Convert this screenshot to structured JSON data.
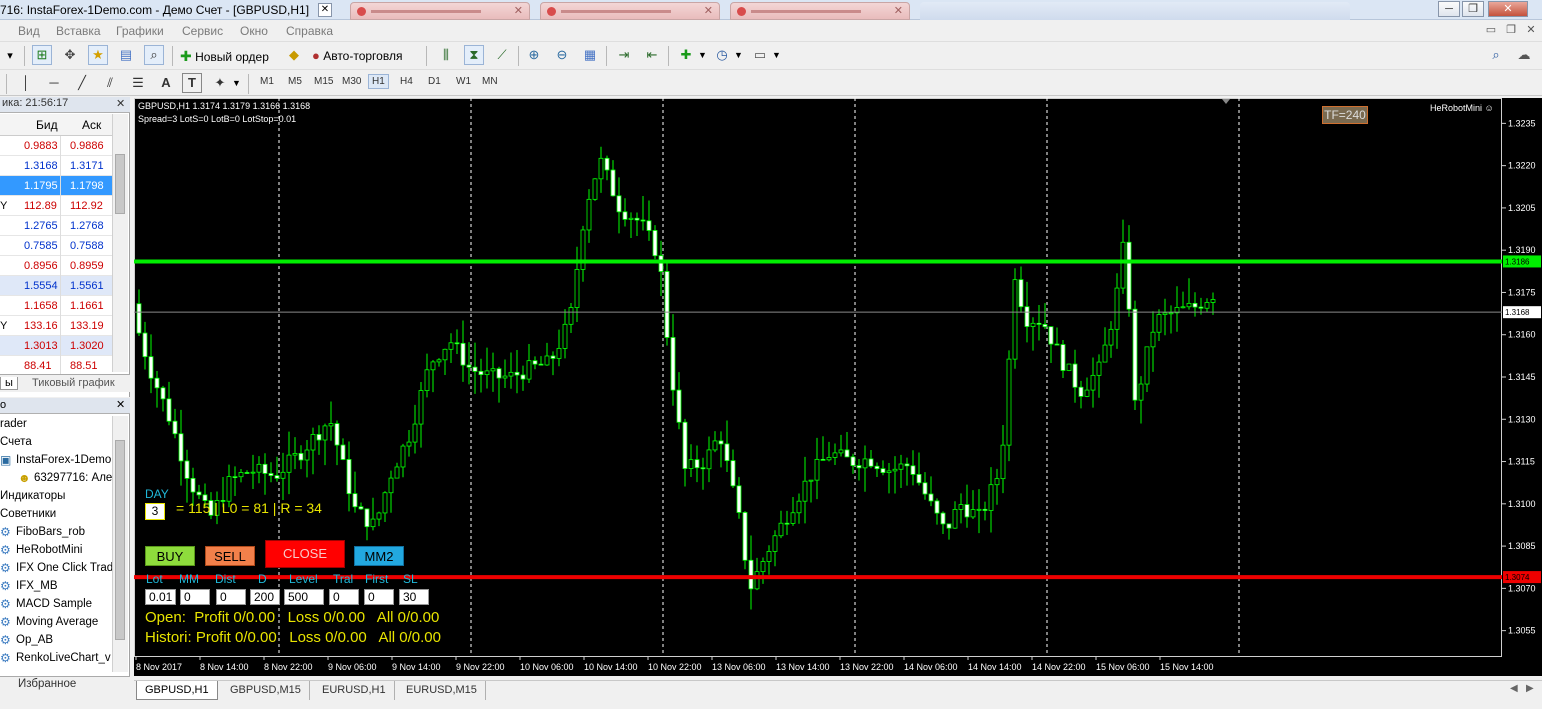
{
  "window": {
    "title": "716: InstaForex-1Demo.com - Демо Счет - [GBPUSD,H1]",
    "buttons": {
      "minimize": "─",
      "restore": "❐",
      "close": "✕"
    }
  },
  "menu": [
    "Вид",
    "Вставка",
    "Графики",
    "Сервис",
    "Окно",
    "Справка"
  ],
  "toolbar": {
    "new_order": "Новый ордер",
    "autotrading": "Авто-торговля",
    "timeframes": [
      "M1",
      "M5",
      "M15",
      "M30",
      "H1",
      "H4",
      "D1",
      "W1",
      "MN"
    ],
    "active_timeframe": "H1",
    "draw_text_tool": "A",
    "text_label_tool": "T"
  },
  "market_watch": {
    "time_header": "ика: 21:56:17",
    "col_bid": "Бид",
    "col_ask": "Аск",
    "rows": [
      {
        "sym": "",
        "bid": "0.9883",
        "ask": "0.9886",
        "color": "#cc0000",
        "bg": "#ffffff"
      },
      {
        "sym": "",
        "bid": "1.3168",
        "ask": "1.3171",
        "color": "#0033cc",
        "bg": "#ffffff"
      },
      {
        "sym": "",
        "bid": "1.1795",
        "ask": "1.1798",
        "color": "#ffffff",
        "bg": "#3399ff"
      },
      {
        "sym": "Y",
        "bid": "112.89",
        "ask": "112.92",
        "color": "#cc0000",
        "bg": "#ffffff"
      },
      {
        "sym": "",
        "bid": "1.2765",
        "ask": "1.2768",
        "color": "#0033cc",
        "bg": "#ffffff"
      },
      {
        "sym": "",
        "bid": "0.7585",
        "ask": "0.7588",
        "color": "#0033cc",
        "bg": "#ffffff"
      },
      {
        "sym": "",
        "bid": "0.8956",
        "ask": "0.8959",
        "color": "#cc0000",
        "bg": "#ffffff"
      },
      {
        "sym": "",
        "bid": "1.5554",
        "ask": "1.5561",
        "color": "#0033cc",
        "bg": "#dfe8f8"
      },
      {
        "sym": "",
        "bid": "1.1658",
        "ask": "1.1661",
        "color": "#cc0000",
        "bg": "#ffffff"
      },
      {
        "sym": "Y",
        "bid": "133.16",
        "ask": "133.19",
        "color": "#cc0000",
        "bg": "#ffffff"
      },
      {
        "sym": "",
        "bid": "1.3013",
        "ask": "1.3020",
        "color": "#cc0000",
        "bg": "#dfe8f8"
      },
      {
        "sym": "",
        "bid": "88.41",
        "ask": "88.51",
        "color": "#cc0000",
        "bg": "#ffffff"
      }
    ],
    "tabs": [
      "ы",
      "Тиковый график"
    ]
  },
  "navigator": {
    "items": [
      {
        "text": "rader",
        "indent": 0,
        "icon": ""
      },
      {
        "text": "Счета",
        "indent": 0,
        "icon": ""
      },
      {
        "text": "InstaForex-1Demo.com",
        "indent": 1,
        "icon": "server-icon"
      },
      {
        "text": "63297716: Але",
        "indent": 2,
        "icon": "user-icon"
      },
      {
        "text": "Индикаторы",
        "indent": 0,
        "icon": ""
      },
      {
        "text": "Советники",
        "indent": 0,
        "icon": ""
      },
      {
        "text": "FiboBars_rob",
        "indent": 1,
        "icon": "ea-icon"
      },
      {
        "text": "HeRobotMini",
        "indent": 1,
        "icon": "ea-icon"
      },
      {
        "text": "IFX One Click Trad",
        "indent": 1,
        "icon": "ea-icon"
      },
      {
        "text": "IFX_MB",
        "indent": 1,
        "icon": "ea-icon"
      },
      {
        "text": "MACD Sample",
        "indent": 1,
        "icon": "ea-icon"
      },
      {
        "text": "Moving Average",
        "indent": 1,
        "icon": "ea-icon"
      },
      {
        "text": "Op_AB",
        "indent": 1,
        "icon": "ea-icon"
      },
      {
        "text": "RenkoLiveChart_v",
        "indent": 1,
        "icon": "ea-icon"
      }
    ],
    "bottom_tab": "Избранное"
  },
  "chart": {
    "header_line1": "GBPUSD,H1  1.3174 1.3179 1.3166 1.3168",
    "header_line2": "Spread=3  LotS=0  LotB=0  LotStop=0.01",
    "tf_badge": "TF=240",
    "robot_name": "HeRobotMini ☺",
    "price_labels": [
      "1.3235",
      "1.3220",
      "1.3205",
      "1.3190",
      "1.3175",
      "1.3160",
      "1.3145",
      "1.3130",
      "1.3115",
      "1.3100",
      "1.3085",
      "1.3070",
      "1.3055"
    ],
    "green_level": "1.3186",
    "current_price": "1.3168",
    "red_level": "1.3074",
    "time_labels": [
      "8 Nov 2017",
      "8 Nov 14:00",
      "8 Nov 22:00",
      "9 Nov 06:00",
      "9 Nov 14:00",
      "9 Nov 22:00",
      "10 Nov 06:00",
      "10 Nov 14:00",
      "10 Nov 22:00",
      "13 Nov 06:00",
      "13 Nov 14:00",
      "13 Nov 22:00",
      "14 Nov 06:00",
      "14 Nov 14:00",
      "14 Nov 22:00",
      "15 Nov 06:00",
      "15 Nov 14:00"
    ],
    "colors": {
      "bull": "#000000",
      "bear": "#ffffff",
      "wick": "#00ff00",
      "green_line": "#00ee00",
      "red_line": "#ee0000"
    }
  },
  "ea_panel": {
    "day_label": "DAY",
    "day_value": "3",
    "day_stats": "= 115 | L0 = 81 | R = 34",
    "buy": "BUY",
    "sell": "SELL",
    "close": "CLOSE",
    "mm2": "MM2",
    "labels": [
      "Lot",
      "MM",
      "Dist",
      "D",
      "Level",
      "Tral",
      "First",
      "SL"
    ],
    "values": [
      "0.01",
      "0",
      "0",
      "200",
      "500",
      "0",
      "0",
      "30"
    ],
    "open_line": "Open:  Profit 0/0.00   Loss 0/0.00   All 0/0.00",
    "histori_line": "Histori: Profit 0/0.00   Loss 0/0.00   All 0/0.00"
  },
  "chart_tabs": [
    "GBPUSD,H1",
    "GBPUSD,M15",
    "EURUSD,H1",
    "EURUSD,M15"
  ],
  "active_chart_tab": "GBPUSD,H1"
}
